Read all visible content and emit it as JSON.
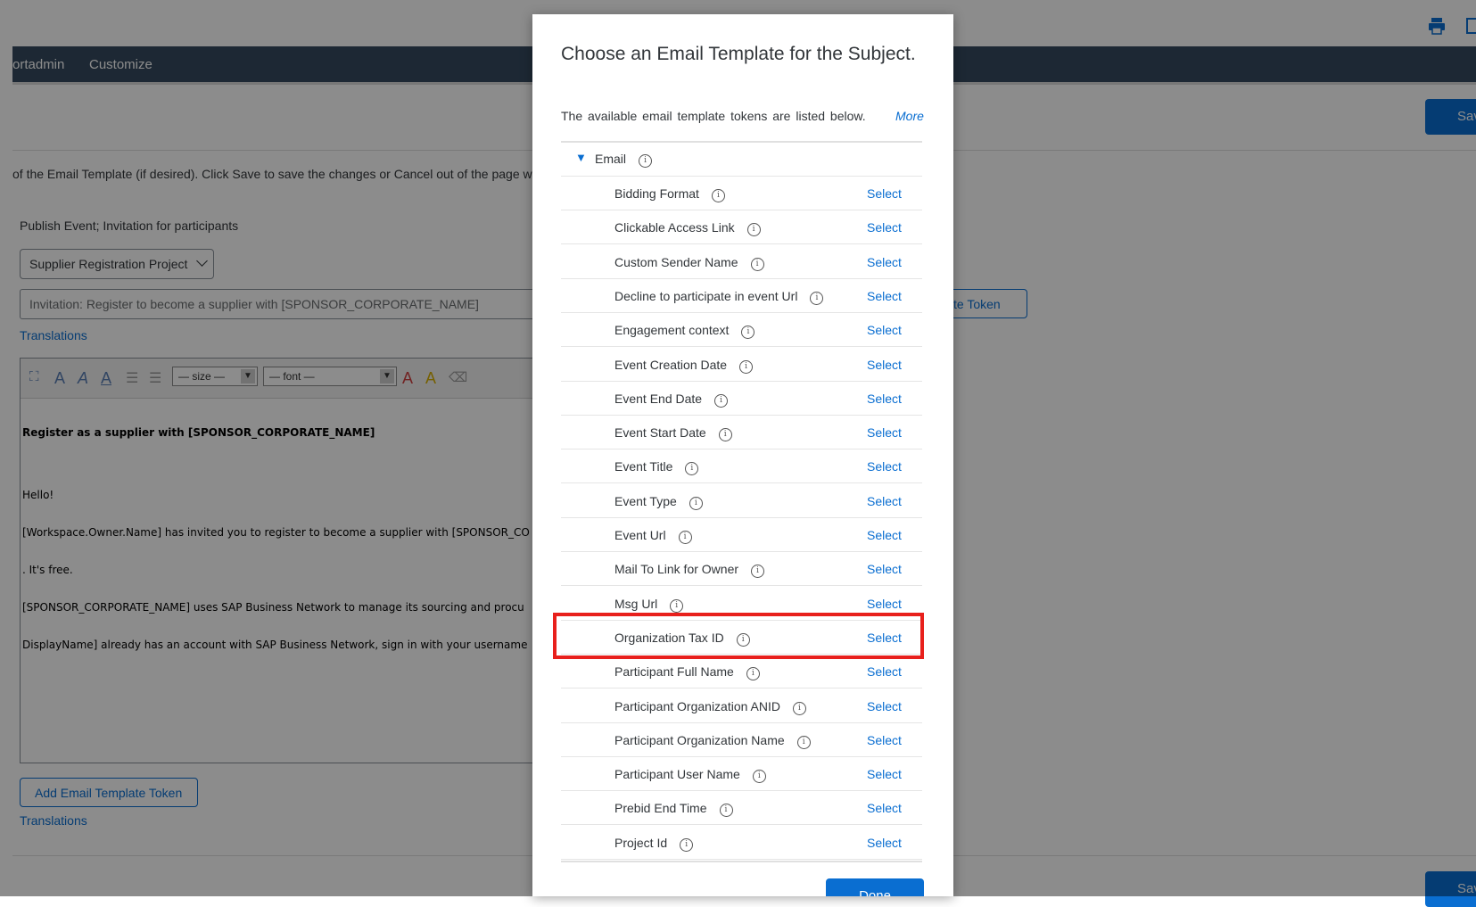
{
  "background": {
    "nav": {
      "items": [
        "ortadmin",
        "Customize"
      ]
    },
    "save_label": "Save",
    "instructions": "of the Email Template (if desired). Click Save to save the changes or Cancel out of the page w",
    "event_label": "Publish Event; Invitation for participants",
    "project_dropdown": "Supplier Registration Project",
    "subject_value": "Invitation: Register to become a supplier with [SPONSOR_CORPORATE_NAME]",
    "token_button_partial": "te Token",
    "translations": "Translations",
    "editor": {
      "size_select": "— size —",
      "font_select": "— font —",
      "heading": "Register as a supplier with [SPONSOR_CORPORATE_NAME]",
      "body_lines": [
        "",
        "Hello!",
        "[Workspace.Owner.Name] has invited you to register to become a supplier with [SPONSOR_CO",
        ". It's free.",
        "[SPONSOR_CORPORATE_NAME] uses SAP Business Network to manage its sourcing and procu",
        "DisplayName] already has an account with SAP Business Network, sign in with your username"
      ]
    },
    "add_token_button": "Add Email Template Token",
    "translations_bottom": "Translations"
  },
  "modal": {
    "title": "Choose an Email Template for the Subject.",
    "description": "The available email template tokens are listed below.",
    "more_link": "More",
    "group_label": "Email",
    "select_label": "Select",
    "rows": [
      "Bidding Format",
      "Clickable Access Link",
      "Custom Sender Name",
      "Decline to participate in event Url",
      "Engagement context",
      "Event Creation Date",
      "Event End Date",
      "Event Start Date",
      "Event Title",
      "Event Type",
      "Event Url",
      "Mail To Link for Owner",
      "Msg Url",
      "Organization Tax ID",
      "Participant Full Name",
      "Participant Organization ANID",
      "Participant Organization Name",
      "Participant User Name",
      "Prebid End Time",
      "Project Id"
    ],
    "highlighted_row": "Organization Tax ID",
    "done_label": "Done"
  },
  "colors": {
    "accent": "#0a6ed1",
    "nav": "#354a5f",
    "highlight": "#e8201c"
  }
}
